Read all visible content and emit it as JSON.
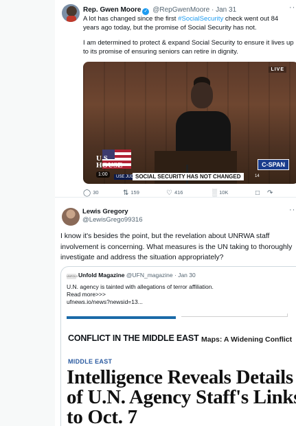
{
  "tweet1": {
    "author_name": "Rep. Gwen Moore",
    "verified_mark": "✓",
    "handle": "@RepGwenMoore",
    "separator": "·",
    "date": "Jan 31",
    "more": "···",
    "text_before_hashtag": "A lot has changed since the first ",
    "hashtag": "#SocialSecurity",
    "text_after_hashtag": " check went out 84 years ago today, but the promise of Social Security has not.",
    "paragraph2": "I am determined to protect & expand Social Security to ensure it lives up to its promise of ensuring seniors can retire in dignity.",
    "video": {
      "live_badge": "LIVE",
      "logo_line1": "U.S.",
      "logo_line2": "HOUSE",
      "network": "C-SPAN",
      "duration": "1:00",
      "chyron_left": "USE JUDICIARY C",
      "chyron_main": "SOCIAL SECURITY HAS NOT CHANGED",
      "chyron_right": "14"
    },
    "actions": {
      "replies": "30",
      "reposts": "159",
      "likes": "416",
      "views": "10K"
    }
  },
  "tweet2": {
    "author_name": "Lewis Gregory",
    "handle": "@LewisGrego99316",
    "more": "···",
    "text": "I know it's besides the point, but the revelation about UNRWA staff involvement is concerning. What measures is the UN taking to thoroughly investigate and address the situation appropriately?",
    "quote": {
      "logo_text": "UNFOLD",
      "author_name": "Unfold Magazine",
      "handle": "@UFN_magazine",
      "separator": "·",
      "date": "Jan 30",
      "line1": "U.N. agency is tainted with allegations of terror affiliation.",
      "line2": "Read more>>>",
      "line3": "ufnews.io/news?newsid=13...",
      "conflict_label": "CONFLICT IN THE MIDDLE EAST",
      "maps_link": "Maps: A Widening Conflict",
      "section": "MIDDLE EAST",
      "headline": "Intelligence Reveals Details of U.N. Agency Staff's Links to Oct. 7"
    }
  },
  "colors": {
    "link_blue": "#1d9bf0",
    "muted_gray": "#536471",
    "border": "#cfd9de",
    "section_blue": "#2a5aa0"
  },
  "icons": [
    "verified-badge-icon",
    "reply-icon",
    "repost-icon",
    "like-icon",
    "views-icon",
    "bookmark-icon",
    "share-icon",
    "more-icon"
  ]
}
